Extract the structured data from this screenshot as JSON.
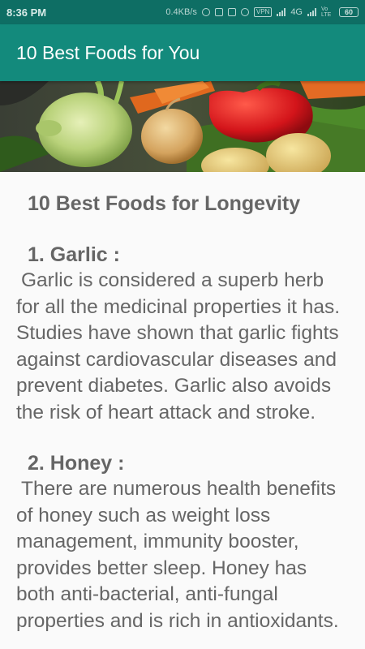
{
  "status_bar": {
    "time": "8:36 PM",
    "network_speed": "0.4KB/s",
    "vpn_label": "VPN",
    "network_type": "4G",
    "volte_label": "Vo LTE",
    "battery": "60"
  },
  "app_bar": {
    "title": "10 Best Foods for You"
  },
  "banner": {
    "icon": "vegetables-image"
  },
  "article": {
    "title": "10 Best Foods for Longevity",
    "sections": [
      {
        "heading": "1. Garlic :",
        "body": "Garlic is considered a superb herb for all the medicinal proper­ties it has. Studies have shown that garlic fights against cardio­vascular diseases and prevent diabetes. Garlic also avoids the risk of heart attack and stroke."
      },
      {
        "heading": "2. Honey :",
        "body": "There are numerous health benefits of honey such as weight loss management, immunity booster, provides better sleep. Honey has both anti-bacterial, anti-fungal properties and is rich in antioxidants."
      }
    ]
  },
  "colors": {
    "status_bar": "#0e6e64",
    "app_bar": "#138a7c",
    "text": "#666666",
    "background": "#fafafa"
  }
}
